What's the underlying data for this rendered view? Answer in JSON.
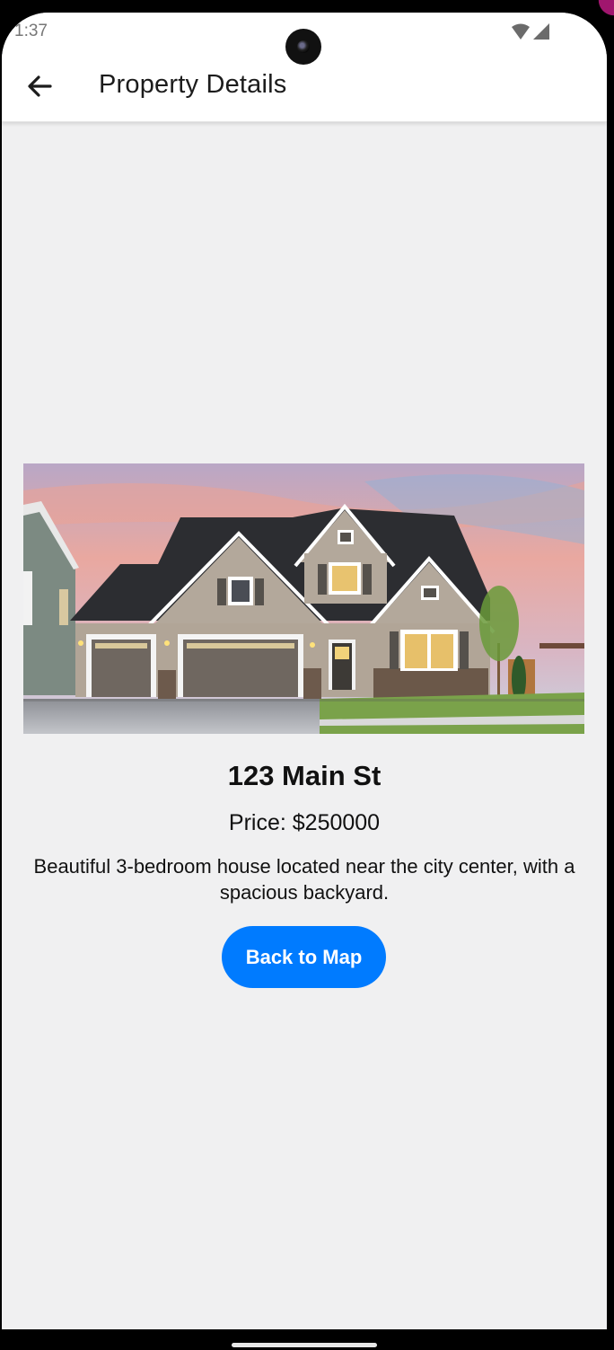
{
  "status_bar": {
    "time": "1:37",
    "wifi_icon": "wifi-icon",
    "signal_icon": "cell-signal-icon"
  },
  "app_bar": {
    "back_icon": "arrow-back-icon",
    "title": "Property Details"
  },
  "property": {
    "image_icon": "house-photo",
    "name": "123 Main St",
    "price": "Price: $250000",
    "description": "Beautiful 3-bedroom house located near the city center, with a spacious backyard.",
    "back_button_label": "Back to Map"
  },
  "colors": {
    "accent": "#007bff",
    "background": "#f0f0f1",
    "app_bar": "#ffffff"
  }
}
